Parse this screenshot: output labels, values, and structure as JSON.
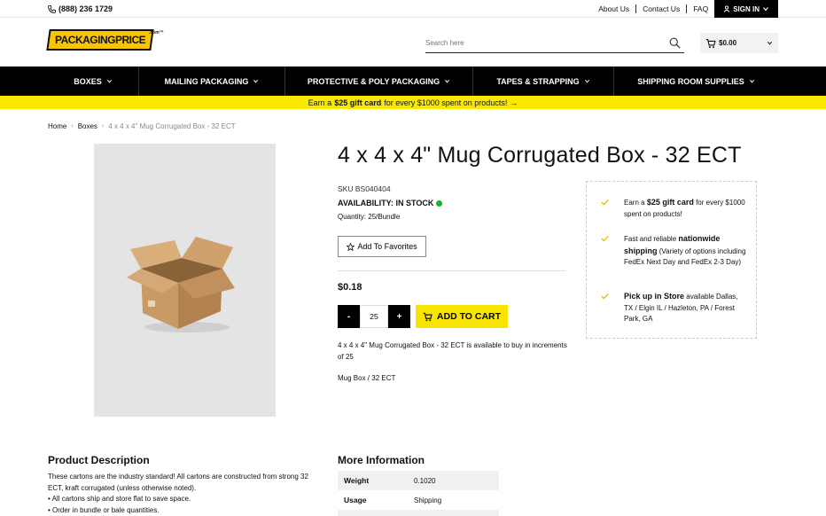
{
  "topbar": {
    "phone": "(888) 236 1729",
    "links": [
      "About Us",
      "Contact Us",
      "FAQ"
    ],
    "signin": "SIGN IN"
  },
  "header": {
    "logo_text": "PACKAGINGPRICE",
    "logo_tm": ".com™",
    "search_placeholder": "Search here",
    "cart_total": "$0.00"
  },
  "nav": {
    "items": [
      "BOXES",
      "MAILING PACKAGING",
      "PROTECTIVE & POLY PACKAGING",
      "TAPES & STRAPPING",
      "SHIPPING ROOM SUPPLIES"
    ]
  },
  "promo": {
    "pre": "Earn a",
    "highlight": "$25 gift card",
    "post": "for every $1000 spent on products!",
    "arrow": "→"
  },
  "breadcrumb": {
    "home": "Home",
    "category": "Boxes",
    "current": "4 x 4 x 4\" Mug Corrugated Box - 32 ECT"
  },
  "product": {
    "title": "4 x 4 x 4\" Mug Corrugated Box - 32 ECT",
    "sku_label": "SKU",
    "sku": "BS040404",
    "availability": "AVAILABILITY: IN STOCK",
    "quantity_note": "Quantity: 25/Bundle",
    "favorites_label": "Add To Favorites",
    "price": "$0.18",
    "minus": "-",
    "plus": "+",
    "qty": "25",
    "add_to_cart": "ADD TO CART",
    "increment_note": "4 x 4 x 4\" Mug Corrugated Box - 32 ECT is available to buy in increments of 25",
    "tags": "Mug Box / 32 ECT",
    "in_stock_color": "#1fae3a"
  },
  "benefits": {
    "b1_pre": "Earn a",
    "b1_bold": "$25 gift card",
    "b1_post": "for every $1000 spent on products!",
    "b2_pre": "Fast and reliable",
    "b2_bold": "nationwide shipping",
    "b2_post": "(Variety of options including FedEx Next Day and FedEx 2-3 Day)",
    "b3_bold": "Pick up in Store",
    "b3_post": "available Dallas, TX / Elgin IL / Hazleton, PA / Forest Park, GA"
  },
  "description": {
    "title": "Product Description",
    "line1": "These cartons are the industry standard! All cartons are constructed from strong 32 ECT, kraft corrugated (unless otherwise noted).",
    "line2": "• All cartons ship and store flat to save space.",
    "line3": "• Order in bundle or bale quantities."
  },
  "more_info": {
    "title": "More Information",
    "rows": [
      {
        "label": "Weight",
        "value": "0.1020"
      },
      {
        "label": "Usage",
        "value": "Shipping"
      }
    ]
  },
  "colors": {
    "accent_yellow": "#f7e400",
    "nav_bg": "#000000"
  }
}
